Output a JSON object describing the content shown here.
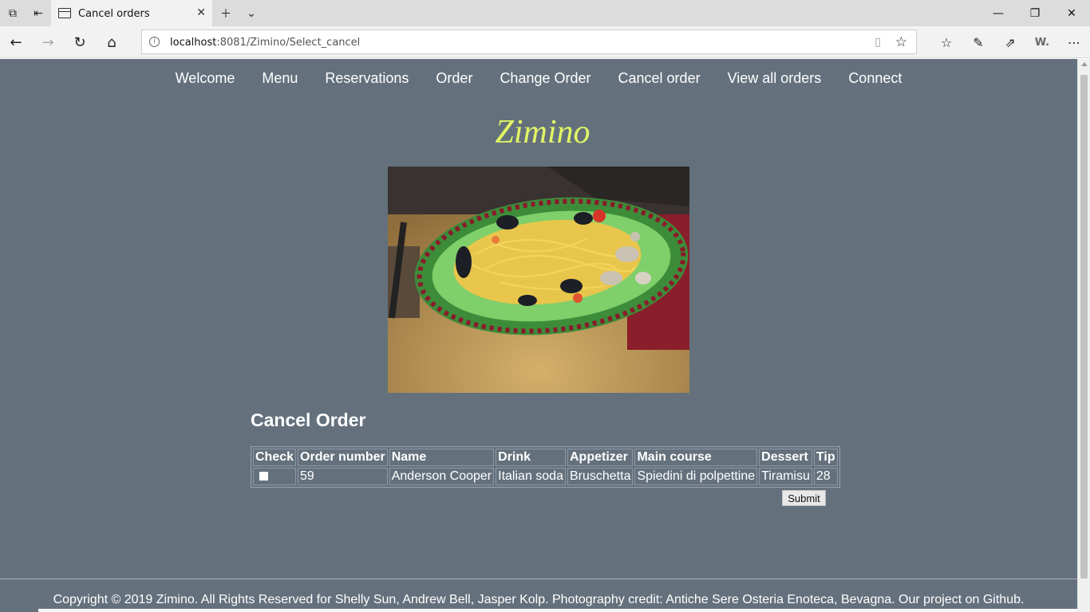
{
  "browser": {
    "tab_title": "Cancel orders",
    "url_host": "localhost",
    "url_rest": ":8081/Zimino/Select_cancel",
    "icons": {
      "tab_actions": "tab-actions-icon",
      "set_aside": "set-aside-tabs-icon",
      "new_tab": "plus-icon",
      "tab_list": "chevron-down-icon",
      "minimize": "minimize-icon",
      "restore": "restore-icon",
      "close": "close-icon",
      "back": "back-arrow-icon",
      "forward": "forward-arrow-icon",
      "refresh": "refresh-icon",
      "home": "home-icon",
      "info": "info-icon",
      "reader": "reading-view-icon",
      "favorite": "star-icon",
      "favorites_hub": "favorites-list-icon",
      "pen": "pen-icon",
      "share": "share-icon",
      "extension": "extension-w-icon",
      "more": "more-icon"
    }
  },
  "site": {
    "nav": [
      "Welcome",
      "Menu",
      "Reservations",
      "Order",
      "Change Order",
      "Cancel order",
      "View all orders",
      "Connect"
    ],
    "brand": "Zimino",
    "colors": {
      "background": "#64717d",
      "brand": "#e2f564",
      "text": "#ffffff"
    }
  },
  "cancel": {
    "title": "Cancel Order",
    "headers": [
      "Check",
      "Order number",
      "Name",
      "Drink",
      "Appetizer",
      "Main course",
      "Dessert",
      "Tip"
    ],
    "rows": [
      {
        "checked": false,
        "order_number": "59",
        "name": "Anderson Cooper",
        "drink": "Italian soda",
        "appetizer": "Bruschetta",
        "main_course": "Spiedini di polpettine",
        "dessert": "Tiramisu",
        "tip": "28"
      }
    ],
    "submit_label": "Submit"
  },
  "footer": {
    "text": "Copyright © 2019 Zimino. All Rights Reserved for Shelly Sun, Andrew Bell, Jasper Kolp. Photography credit: Antiche Sere Osteria Enoteca, Bevagna. Our project on Github."
  }
}
